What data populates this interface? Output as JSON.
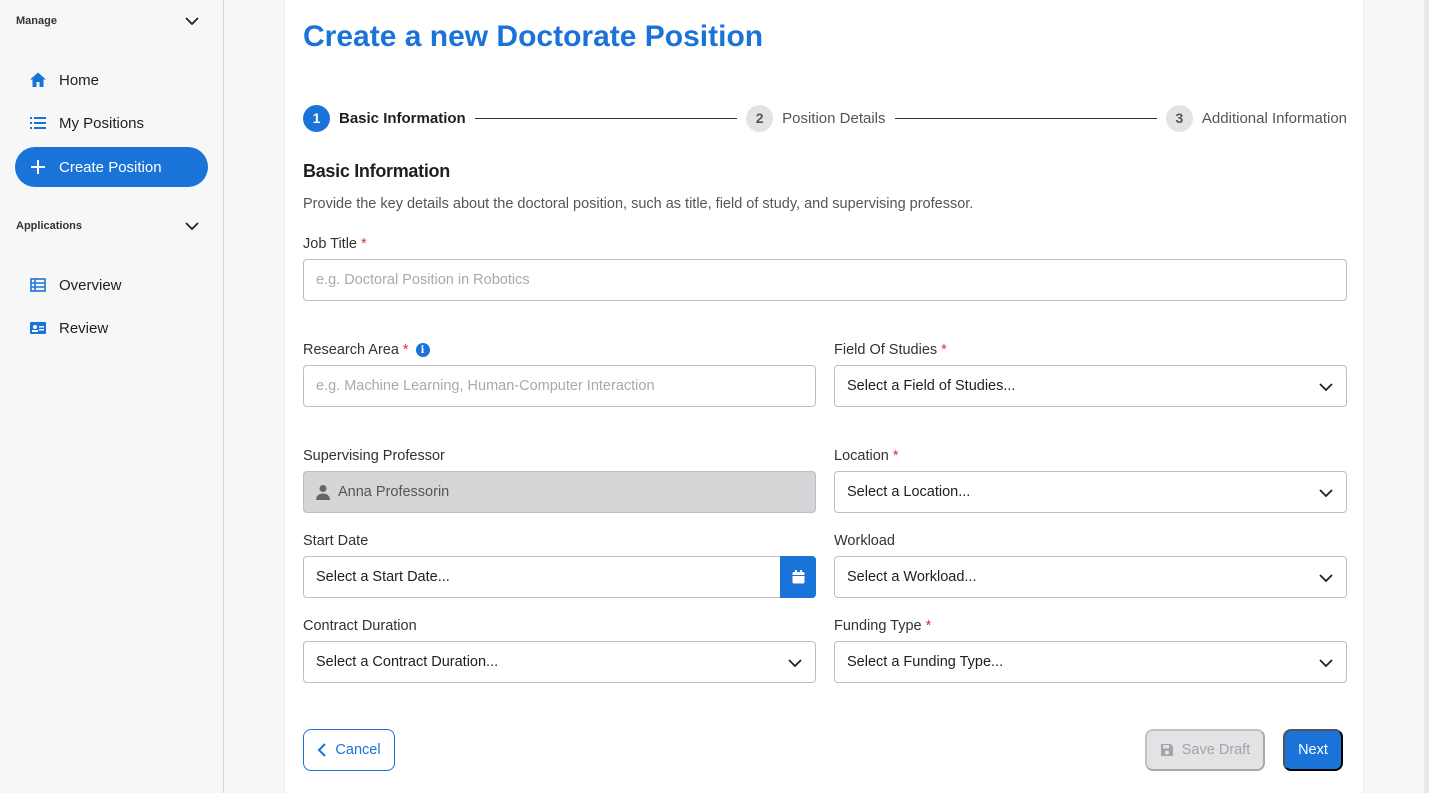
{
  "sidebar": {
    "manage_label": "Manage",
    "applications_label": "Applications",
    "items": [
      {
        "label": "Home",
        "icon": "home-icon"
      },
      {
        "label": "My Positions",
        "icon": "list-icon"
      },
      {
        "label": "Create Position",
        "icon": "plus-icon",
        "active": true
      },
      {
        "label": "Overview",
        "icon": "table-icon"
      },
      {
        "label": "Review",
        "icon": "id-card-icon"
      }
    ]
  },
  "page": {
    "title": "Create a new Doctorate Position"
  },
  "stepper": {
    "steps": [
      {
        "num": "1",
        "label": "Basic Information",
        "active": true
      },
      {
        "num": "2",
        "label": "Position Details",
        "active": false
      },
      {
        "num": "3",
        "label": "Additional Information",
        "active": false
      }
    ]
  },
  "section": {
    "title": "Basic Information",
    "description": "Provide the key details about the doctoral position, such as title, field of study, and supervising professor."
  },
  "form": {
    "job_title": {
      "label": "Job Title",
      "required": "*",
      "placeholder": "e.g. Doctoral Position in Robotics"
    },
    "research_area": {
      "label": "Research Area",
      "required": "*",
      "placeholder": "e.g. Machine Learning, Human-Computer Interaction"
    },
    "field_of_studies": {
      "label": "Field Of Studies",
      "required": "*",
      "value": "Select a Field of Studies..."
    },
    "supervising_professor": {
      "label": "Supervising Professor",
      "value": "Anna Professorin"
    },
    "location": {
      "label": "Location",
      "required": "*",
      "value": "Select a Location..."
    },
    "start_date": {
      "label": "Start Date",
      "value": "Select a Start Date..."
    },
    "workload": {
      "label": "Workload",
      "value": "Select a Workload..."
    },
    "contract_duration": {
      "label": "Contract Duration",
      "value": "Select a Contract Duration..."
    },
    "funding_type": {
      "label": "Funding Type",
      "required": "*",
      "value": "Select a Funding Type..."
    }
  },
  "actions": {
    "cancel": "Cancel",
    "save_draft": "Save Draft",
    "next": "Next"
  },
  "colors": {
    "accent": "#1a73d9",
    "required": "#d9342b"
  }
}
